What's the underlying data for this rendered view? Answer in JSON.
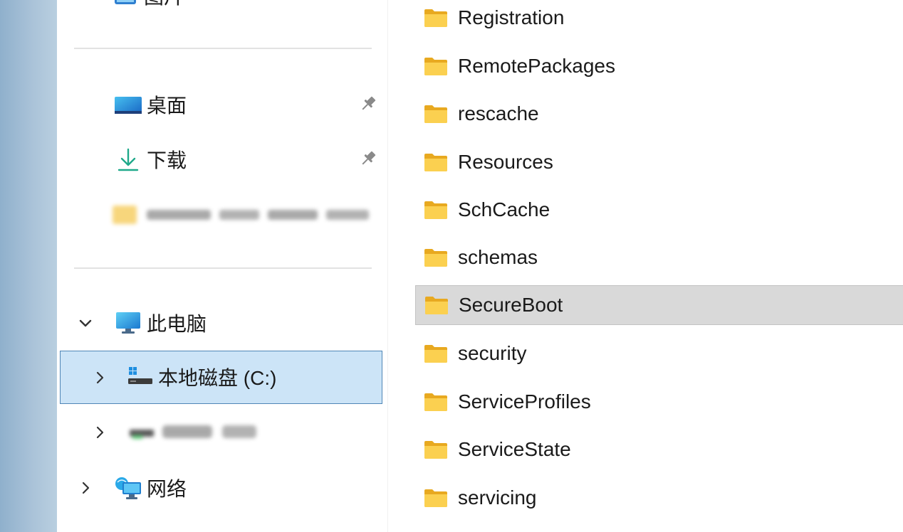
{
  "nav": {
    "partial_top_label": "图片",
    "quick_access": [
      {
        "label": "桌面",
        "icon": "desktop-icon",
        "pinned": true
      },
      {
        "label": "下载",
        "icon": "download-arrow-icon",
        "pinned": true
      }
    ],
    "this_pc": {
      "label": "此电脑",
      "expanded": true
    },
    "drives": [
      {
        "label": "本地磁盘 (C:)",
        "selected": true
      }
    ],
    "network": {
      "label": "网络"
    }
  },
  "files": [
    {
      "name": "Registration"
    },
    {
      "name": "RemotePackages"
    },
    {
      "name": "rescache"
    },
    {
      "name": "Resources"
    },
    {
      "name": "SchCache"
    },
    {
      "name": "schemas"
    },
    {
      "name": "SecureBoot",
      "selected": true
    },
    {
      "name": "security"
    },
    {
      "name": "ServiceProfiles"
    },
    {
      "name": "ServiceState"
    },
    {
      "name": "servicing"
    }
  ],
  "colors": {
    "selection_blue": "#cce4f7",
    "selection_border": "#4f86b6",
    "row_selected_gray": "#d9d9d9",
    "folder_yellow": "#f8c843"
  }
}
